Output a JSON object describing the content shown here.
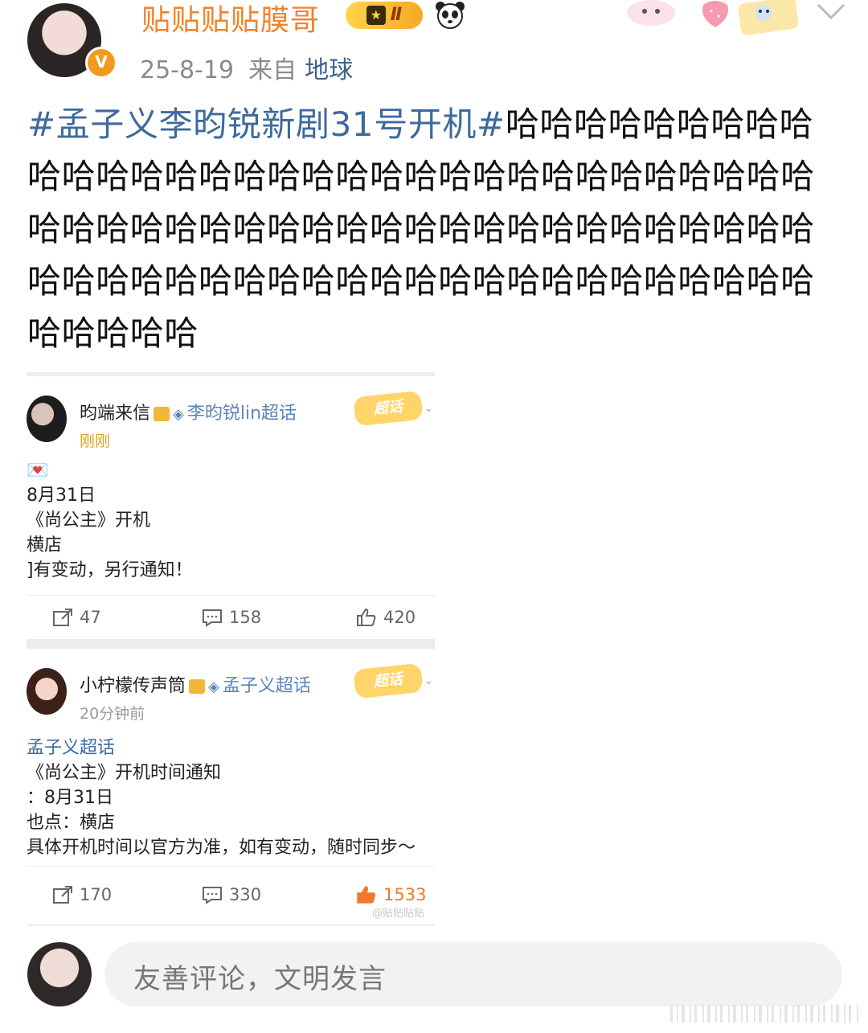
{
  "post": {
    "username": "贴贴贴贴膜哥",
    "level_badge": "Ⅱ",
    "date": "25-8-19",
    "source_prefix": "来自",
    "location": "地球",
    "topic": "#孟子义李昀锐新剧31号开机#",
    "text": "哈哈哈哈哈哈哈哈哈哈哈哈哈哈哈哈哈哈哈哈哈哈哈哈哈哈哈哈哈哈哈哈哈哈哈哈哈哈哈哈哈哈哈哈哈哈哈哈哈哈哈哈哈哈哈哈哈哈哈哈哈哈哈哈哈哈哈哈哈哈哈哈哈哈哈哈哈哈哈哈哈哈哈"
  },
  "cards": [
    {
      "name": "昀端来信",
      "topic": "李昀锐lin超话",
      "time": "刚刚",
      "badge": "超话",
      "line1": "💌",
      "line2": "8月31日",
      "line3": "《尚公主》开机",
      "line4": "横店",
      "line5": "]有变动，另行通知！",
      "reposts": "47",
      "comments": "158",
      "likes": "420"
    },
    {
      "name": "小柠檬传声筒",
      "topic": "孟子义超话",
      "time": "20分钟前",
      "badge": "超话",
      "line1": "孟子义超话",
      "line2": "《尚公主》开机时间通知",
      "line3": "：8月31日",
      "line4": "也点：横店",
      "line5": "具体开机时间以官方为准，如有变动，随时同步～",
      "reposts": "170",
      "comments": "330",
      "likes": "1533",
      "watermark": "@贴贴贴贴"
    }
  ],
  "comment_bar": {
    "placeholder": "友善评论，文明发言"
  },
  "colors": {
    "username": "#f0832a",
    "topic": "#3e6a9c",
    "like_active": "#f07a2a"
  }
}
